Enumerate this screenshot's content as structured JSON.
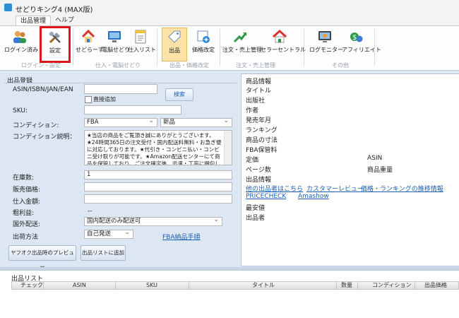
{
  "window": {
    "title": "せどりキング4 (MAX版)"
  },
  "ribbon_tabs": [
    "出品管理",
    "ヘルプ"
  ],
  "ribbon": {
    "buttons": [
      "ログイン済み",
      "設定",
      "せどらーず",
      "電脳せどり",
      "仕入リスト",
      "出品",
      "価格改定",
      "注文・売上管理",
      "セラーセントラル",
      "ログモニター",
      "アフィリエイト"
    ],
    "groups": [
      "ログイン・設定",
      "仕入・電脳せどり",
      "出品・価格改定",
      "注文・売上管理",
      "その他"
    ]
  },
  "listing": {
    "section_title": "出品登録",
    "asin_label": "ASIN/ISBN/JAN/EAN",
    "search_button": "検索",
    "direct_add_label": "直接追加",
    "sku_label": "SKU:",
    "condition_label": "コンディション:",
    "condition_value": "FBA",
    "condition_new": "新品",
    "condition_desc_label": "コンディション説明：",
    "condition_desc": "★当店の商品をご覧頂き誠にありがとうございます。★24時間365日の注文受付・国内配送料無料・お急ぎ便に対応しております。★代引き・コンビニ払い・コンビニ受け取りが可能です。★Amazon配送センターにて商品を保管しており、ご注文確定後、迅速・丁寧に梱包し発送を行な",
    "stock_label": "在庫数:",
    "stock_value": "1",
    "price_label": "販売価格:",
    "cost_label": "仕入金額:",
    "profit_label": "粗利益:",
    "profit_value": "--",
    "overseas_label": "国外配送:",
    "overseas_value": "国内配送のみ配送可",
    "shipping_label": "出荷方法",
    "shipping_value": "自己発送",
    "fba_link": "FBA納品手順",
    "preview_button": "ヤフオク出品時のプレビュー",
    "add_list_button": "出品リストに追加"
  },
  "product_info": {
    "title": "商品情報",
    "fields": [
      "タイトル",
      "出版社",
      "作者",
      "発売年月",
      "ランキング",
      "商品の寸法",
      "FBA保管料",
      "定価",
      "ページ数",
      "出品情報"
    ],
    "asin_label": "ASIN",
    "weight_label": "商品重量",
    "links": [
      "他の出品者はこちら",
      "カスタマーレビュー",
      "価格・ランキングの推移情報",
      "PRICECHECK",
      "Amashow"
    ],
    "lowest_label": "最安値",
    "seller_label": "出品者"
  },
  "product_list": {
    "title": "出品リスト",
    "columns": [
      "チェック",
      "ASIN",
      "SKU",
      "タイトル",
      "数量",
      "コンディション",
      "出品価格"
    ]
  }
}
